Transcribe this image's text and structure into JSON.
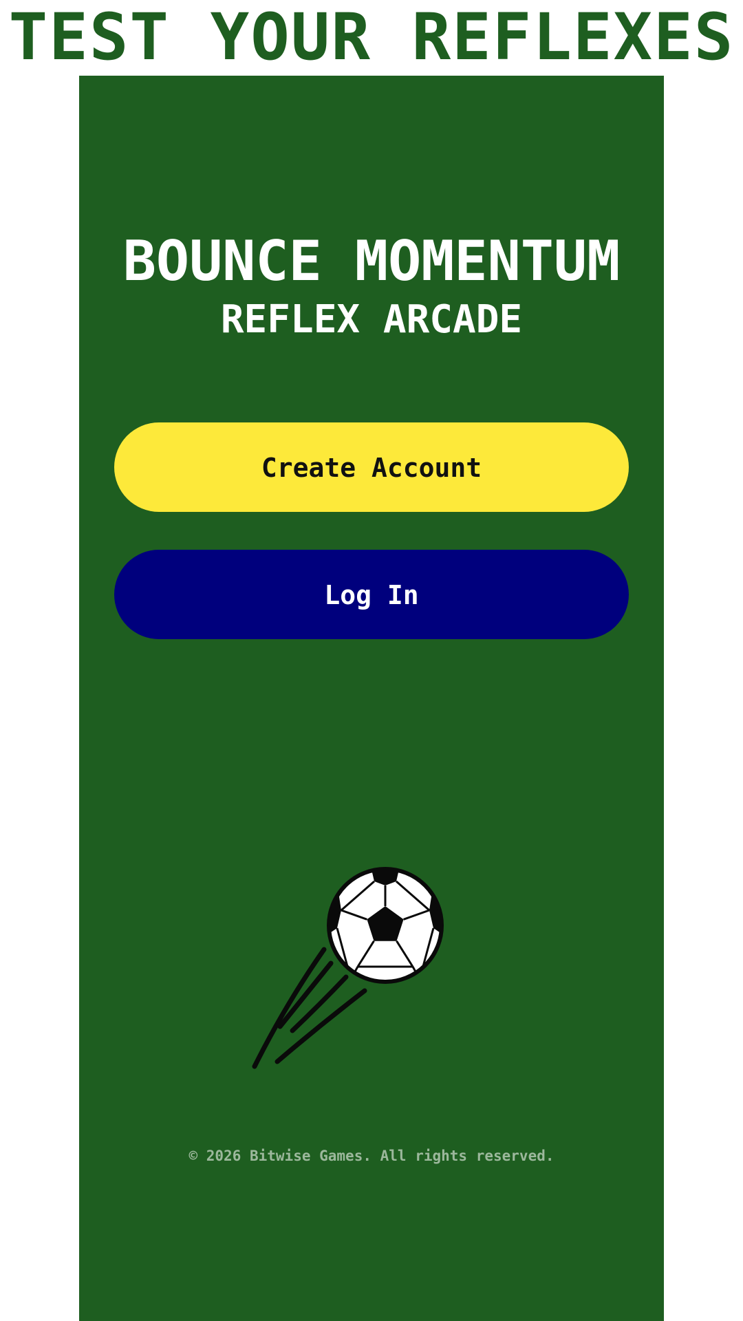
{
  "banner": {
    "text": "TEST YOUR REFLEXES"
  },
  "game": {
    "title": "BOUNCE MOMENTUM",
    "subtitle": "REFLEX ARCADE"
  },
  "buttons": {
    "create_account": "Create Account",
    "log_in": "Log In"
  },
  "illustration": {
    "icon": "soccer-ball-icon"
  },
  "footer": {
    "copyright": "© 2026 Bitwise Games. All rights reserved."
  },
  "colors": {
    "brand_green": "#1e5e20",
    "create_button": "#fde93a",
    "login_button": "#00007d",
    "footer_text": "#9cb89c"
  }
}
